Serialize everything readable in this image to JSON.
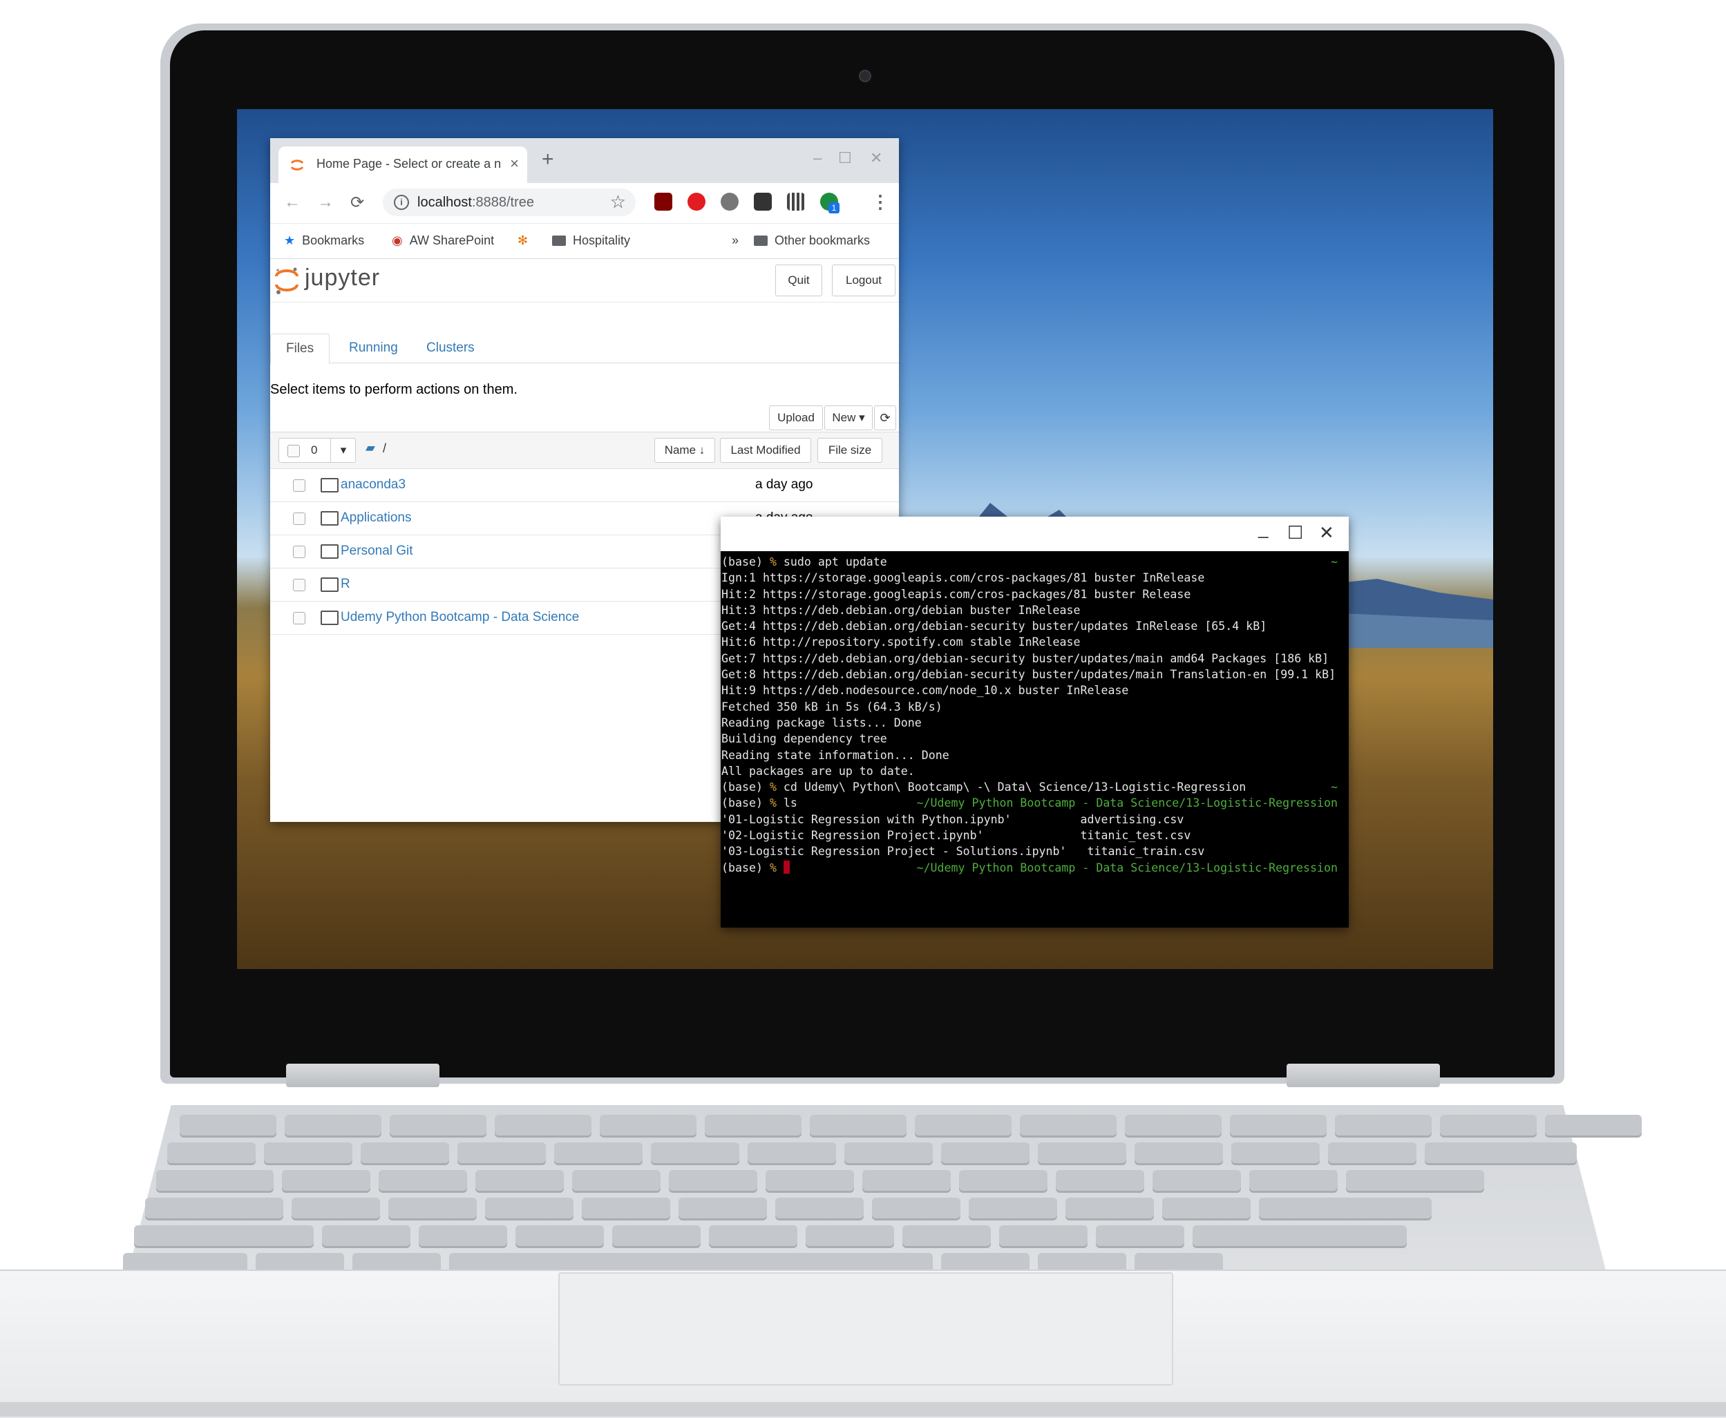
{
  "browser": {
    "tab_title": "Home Page - Select or create a n",
    "tab_close": "×",
    "new_tab": "+",
    "window_controls": {
      "minimize": "–",
      "maximize": "☐",
      "close": "✕"
    },
    "nav": {
      "back": "←",
      "forward": "→",
      "reload": "⟳"
    },
    "url_host": "localhost",
    "url_path": ":8888/tree",
    "bookmarks": [
      {
        "label": "Bookmarks",
        "icon": "star-icon"
      },
      {
        "label": "AW SharePoint",
        "icon": "sharepoint-icon"
      },
      {
        "label": "",
        "icon": "asterisk-icon"
      },
      {
        "label": "Hospitality",
        "icon": "folder-icon"
      }
    ],
    "bookmarks_overflow": "»",
    "other_bookmarks": "Other bookmarks",
    "extensions": [
      "ublock-icon",
      "adblock-icon",
      "circle-icon",
      "selenium-icon",
      "qr-icon",
      "profile-icon"
    ],
    "extension_badge": "1"
  },
  "jupyter": {
    "logo_text": "jupyter",
    "quit_label": "Quit",
    "logout_label": "Logout",
    "tabs": [
      "Files",
      "Running",
      "Clusters"
    ],
    "active_tab": "Files",
    "hint": "Select items to perform actions on them.",
    "upload_label": "Upload",
    "new_label": "New ▾",
    "refresh_icon": "refresh-icon",
    "selected_count": "0",
    "path": "/",
    "sort_name": "Name ↓",
    "sort_modified": "Last Modified",
    "sort_size": "File size",
    "files": [
      {
        "name": "anaconda3",
        "modified": "a day ago"
      },
      {
        "name": "Applications",
        "modified": "a day ago"
      },
      {
        "name": "Personal Git",
        "modified": ""
      },
      {
        "name": "R",
        "modified": ""
      },
      {
        "name": "Udemy Python Bootcamp - Data Science",
        "modified": ""
      }
    ]
  },
  "terminal": {
    "controls": {
      "minimize": "_",
      "maximize": "☐",
      "close": "✕"
    },
    "lines": [
      {
        "prompt": "(base) ",
        "pct": "%",
        "text": " sudo apt update",
        "right": "~"
      },
      {
        "text": "Ign:1 https://storage.googleapis.com/cros-packages/81 buster InRelease"
      },
      {
        "text": "Hit:2 https://storage.googleapis.com/cros-packages/81 buster Release"
      },
      {
        "text": "Hit:3 https://deb.debian.org/debian buster InRelease"
      },
      {
        "text": "Get:4 https://deb.debian.org/debian-security buster/updates InRelease [65.4 kB]"
      },
      {
        "text": "Hit:6 http://repository.spotify.com stable InRelease"
      },
      {
        "text": "Get:7 https://deb.debian.org/debian-security buster/updates/main amd64 Packages [186 kB]"
      },
      {
        "text": "Get:8 https://deb.debian.org/debian-security buster/updates/main Translation-en [99.1 kB]"
      },
      {
        "text": "Hit:9 https://deb.nodesource.com/node_10.x buster InRelease"
      },
      {
        "text": "Fetched 350 kB in 5s (64.3 kB/s)"
      },
      {
        "text": "Reading package lists... Done"
      },
      {
        "text": "Building dependency tree"
      },
      {
        "text": "Reading state information... Done"
      },
      {
        "text": "All packages are up to date."
      },
      {
        "prompt": "(base) ",
        "pct": "%",
        "text": " cd Udemy\\ Python\\ Bootcamp\\ -\\ Data\\ Science/13-Logistic-Regression",
        "right": "~"
      },
      {
        "prompt": "(base) ",
        "pct": "%",
        "text": " ls",
        "right": "~/Udemy Python Bootcamp - Data Science/13-Logistic-Regression"
      },
      {
        "text": "'01-Logistic Regression with Python.ipynb'          advertising.csv"
      },
      {
        "text": "'02-Logistic Regression Project.ipynb'              titanic_test.csv"
      },
      {
        "text": "'03-Logistic Regression Project - Solutions.ipynb'   titanic_train.csv"
      },
      {
        "prompt": "(base) ",
        "pct": "%",
        "text": " ",
        "cursor": true,
        "right": "~/Udemy Python Bootcamp - Data Science/13-Logistic-Regression"
      }
    ]
  },
  "colors": {
    "jupyter_orange": "#f37626",
    "link_blue": "#337ab7",
    "prompt_green": "#4fae3c",
    "cursor_red": "#b3001b"
  }
}
